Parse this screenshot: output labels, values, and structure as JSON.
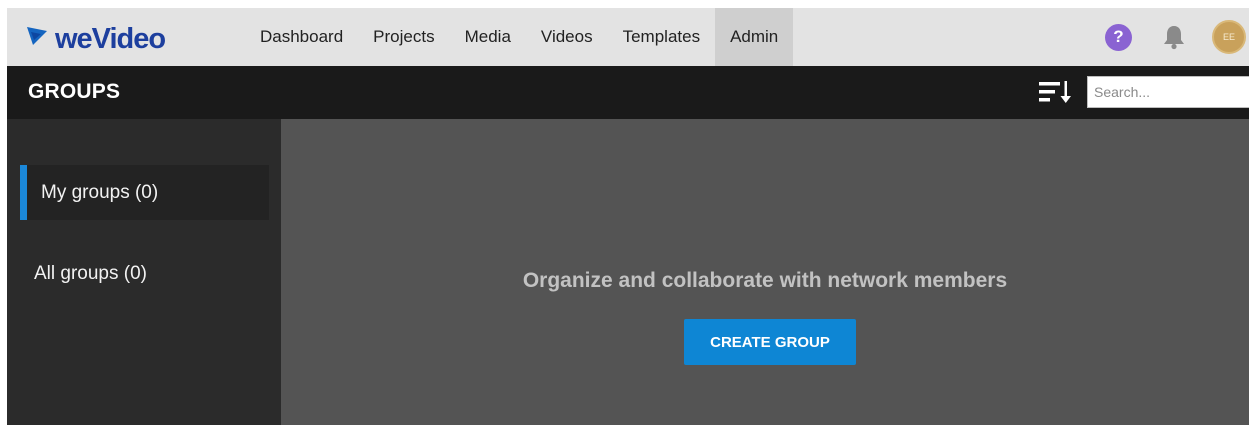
{
  "brand": {
    "name": "weVideo"
  },
  "nav": {
    "items": [
      {
        "label": "Dashboard",
        "active": false
      },
      {
        "label": "Projects",
        "active": false
      },
      {
        "label": "Media",
        "active": false
      },
      {
        "label": "Videos",
        "active": false
      },
      {
        "label": "Templates",
        "active": false
      },
      {
        "label": "Admin",
        "active": true
      }
    ]
  },
  "top_icons": {
    "help_glyph": "?",
    "avatar_initials": "EE"
  },
  "header": {
    "title": "GROUPS",
    "search_placeholder": "Search..."
  },
  "sidebar": {
    "items": [
      {
        "label": "My groups (0)",
        "selected": true
      },
      {
        "label": "All groups (0)",
        "selected": false
      }
    ]
  },
  "main": {
    "empty_message": "Organize and collaborate with network members",
    "create_button": "CREATE GROUP"
  },
  "colors": {
    "accent_blue": "#0e86d4",
    "help_purple": "#8a63d2",
    "avatar_gold": "#c9a15b"
  }
}
